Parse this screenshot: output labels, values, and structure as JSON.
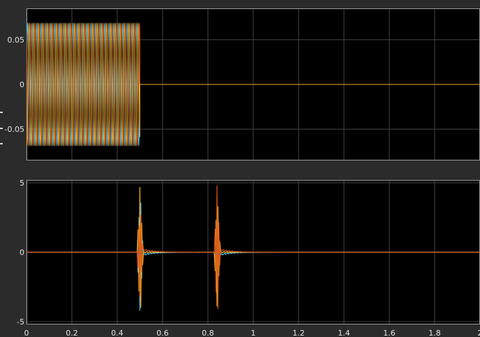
{
  "chart_data": [
    {
      "type": "line",
      "title": "",
      "xlabel": "",
      "ylabel": "",
      "xlim": [
        0,
        2
      ],
      "ylim": [
        -0.085,
        0.085
      ],
      "y_ticks": [
        -0.05,
        0,
        0.05
      ],
      "y_tick_labels": [
        "-0.05",
        "0",
        "0.05"
      ],
      "x_ticks": [
        0,
        0.2,
        0.4,
        0.6,
        0.8,
        1,
        1.2,
        1.4,
        1.6,
        1.8,
        2
      ],
      "x_tick_labels": [],
      "grid": true,
      "background": "#000000",
      "series": [
        {
          "color": "#4DBEEE",
          "amplitude": 0.068,
          "phase_deg": 0,
          "frequency_hz": 50,
          "active_until": 0.5
        },
        {
          "color": "#D95319",
          "amplitude": 0.068,
          "phase_deg": 120,
          "frequency_hz": 50,
          "active_until": 0.5
        },
        {
          "color": "#EDB120",
          "amplitude": 0.068,
          "phase_deg": 240,
          "frequency_hz": 50,
          "active_until": 0.5
        }
      ]
    },
    {
      "type": "line",
      "title": "",
      "xlabel": "",
      "ylabel": "",
      "xlim": [
        0,
        2
      ],
      "ylim": [
        -5.2,
        5.2
      ],
      "y_ticks": [
        -5,
        0,
        5
      ],
      "y_tick_labels": [
        "-5",
        "0",
        "5"
      ],
      "x_ticks": [
        0,
        0.2,
        0.4,
        0.6,
        0.8,
        1,
        1.2,
        1.4,
        1.6,
        1.8,
        2
      ],
      "x_tick_labels": [
        "0",
        "0.2",
        "0.4",
        "0.6",
        "0.8",
        "1",
        "1.2",
        "1.4",
        "1.6",
        "1.8",
        "2"
      ],
      "grid": true,
      "background": "#000000",
      "transients": [
        {
          "time": 0.5,
          "peaks": [
            {
              "color": "#EDB120",
              "value": 4.7
            },
            {
              "color": "#4DBEEE",
              "value": -4.2
            },
            {
              "color": "#D95319",
              "value": -3.2
            }
          ]
        },
        {
          "time": 0.84,
          "peaks": [
            {
              "color": "#D95319",
              "value": 4.8
            },
            {
              "color": "#EDB120",
              "value": -3.9
            },
            {
              "color": "#4DBEEE",
              "value": -3.0
            }
          ]
        }
      ],
      "series_colors": [
        "#4DBEEE",
        "#EDB120",
        "#D95319"
      ]
    }
  ]
}
